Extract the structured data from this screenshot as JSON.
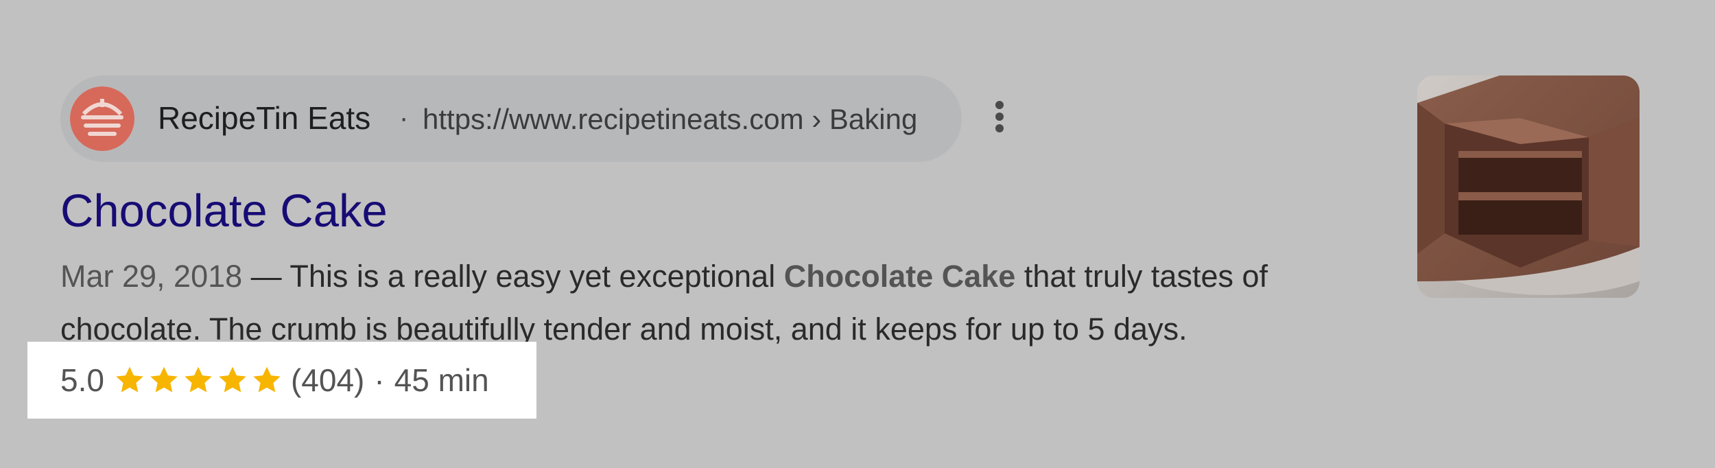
{
  "result": {
    "site_name": "RecipeTin Eats",
    "separator": "·",
    "url": "https://www.recipetineats.com › Baking",
    "title": "Chocolate Cake",
    "snippet": {
      "date": "Mar 29, 2018",
      "dash": " — ",
      "text_before": "This is a really easy yet exceptional ",
      "bold": "Chocolate Cake",
      "text_after": " that truly tastes of chocolate. The crumb is beautifully tender and moist, and it keeps for up to 5 days."
    },
    "rating": {
      "score": "5.0",
      "stars_filled": 5,
      "stars_total": 5,
      "reviews": "(404)",
      "separator": "·",
      "time": "45 min"
    }
  },
  "icons": {
    "favicon": "recipetin-eats-logo-icon",
    "more": "more-vertical-icon",
    "star": "star-icon",
    "thumbnail": "chocolate-cake-thumbnail"
  },
  "colors": {
    "page_background": "#c1c1c1",
    "pill_background": "#b7b8ba",
    "title_link": "#170c74",
    "star": "#f7b500",
    "favicon_red": "#d6695a",
    "highlight_box": "#ffffff"
  }
}
